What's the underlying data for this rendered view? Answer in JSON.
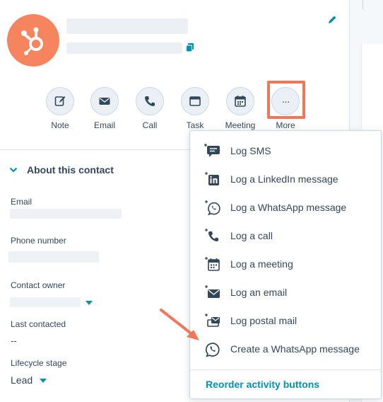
{
  "actions": [
    {
      "label": "Note",
      "icon": "note-icon"
    },
    {
      "label": "Email",
      "icon": "email-icon"
    },
    {
      "label": "Call",
      "icon": "phone-icon"
    },
    {
      "label": "Task",
      "icon": "task-icon"
    },
    {
      "label": "Meeting",
      "icon": "calendar-icon"
    },
    {
      "label": "More",
      "icon": "ellipsis-icon",
      "glyph": "···"
    }
  ],
  "about": {
    "title": "About this contact",
    "fields": [
      {
        "label": "Email"
      },
      {
        "label": "Phone number"
      },
      {
        "label": "Contact owner"
      },
      {
        "label": "Last contacted",
        "value": "--"
      },
      {
        "label": "Lifecycle stage",
        "value": "Lead"
      }
    ]
  },
  "more_menu": {
    "items": [
      {
        "label": "Log SMS",
        "icon": "log-sms-icon"
      },
      {
        "label": "Log a LinkedIn message",
        "icon": "log-linkedin-icon"
      },
      {
        "label": "Log a WhatsApp message",
        "icon": "log-whatsapp-icon"
      },
      {
        "label": "Log a call",
        "icon": "log-call-icon"
      },
      {
        "label": "Log a meeting",
        "icon": "log-meeting-icon"
      },
      {
        "label": "Log an email",
        "icon": "log-email-icon"
      },
      {
        "label": "Log postal mail",
        "icon": "log-postal-mail-icon"
      },
      {
        "label": "Create a WhatsApp message",
        "icon": "whatsapp-icon"
      }
    ],
    "reorder_label": "Reorder activity buttons"
  },
  "colors": {
    "brand_orange": "#f5845f",
    "highlight": "#f0785a",
    "link_teal": "#0091ae",
    "text": "#33475b"
  }
}
